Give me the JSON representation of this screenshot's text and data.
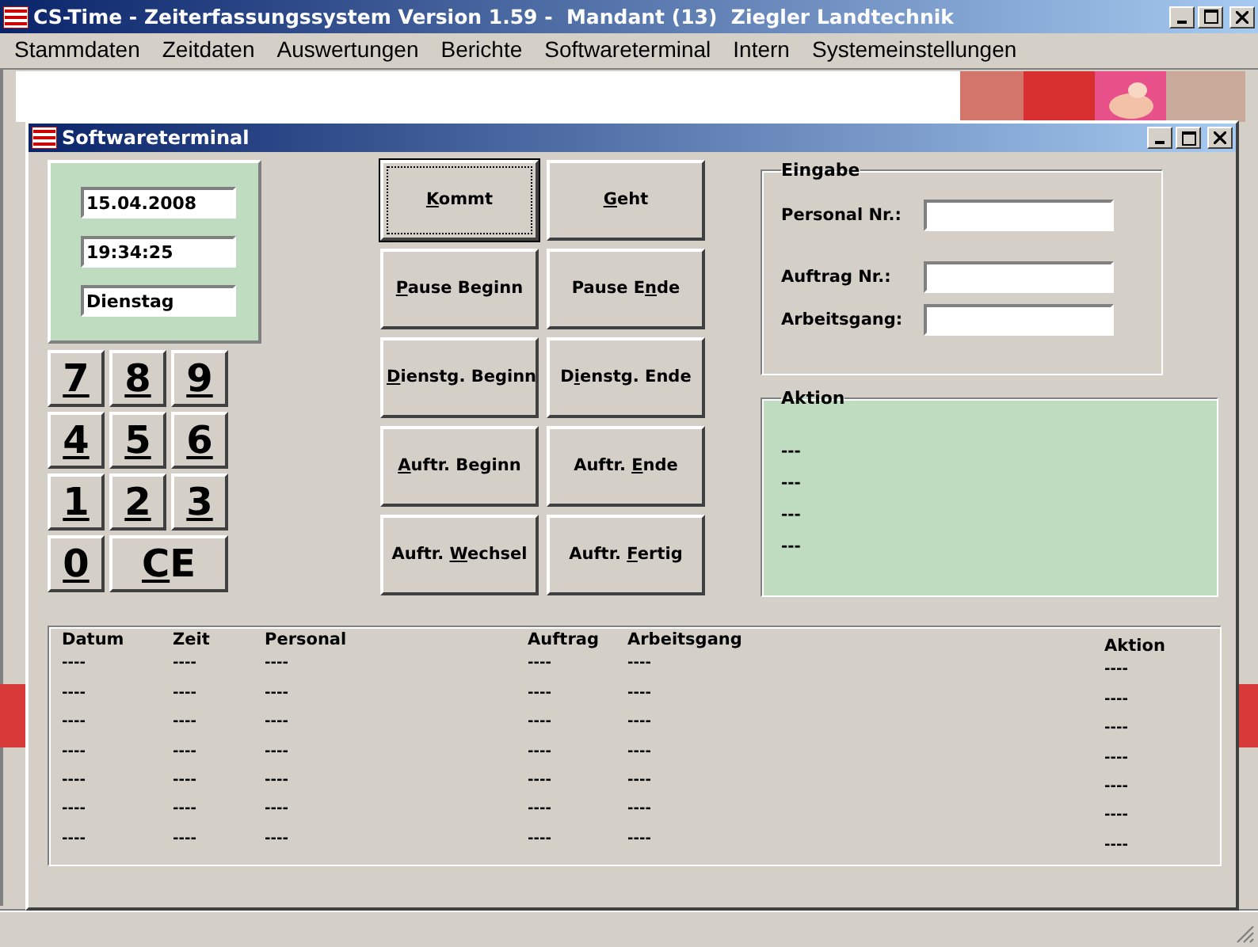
{
  "window": {
    "title": "CS-Time - Zeiterfassungssystem Version 1.59 -  Mandant (13)  Ziegler Landtechnik"
  },
  "menu": [
    "Stammdaten",
    "Zeitdaten",
    "Auswertungen",
    "Berichte",
    "Softwareterminal",
    "Intern",
    "Systemeinstellungen"
  ],
  "terminal": {
    "title": "Softwareterminal",
    "date": "15.04.2008",
    "time": "19:34:25",
    "weekday": "Dienstag",
    "keypad": [
      {
        "key": "7"
      },
      {
        "key": "8"
      },
      {
        "key": "9"
      },
      {
        "key": "4"
      },
      {
        "key": "5"
      },
      {
        "key": "6"
      },
      {
        "key": "1"
      },
      {
        "key": "2"
      },
      {
        "key": "3"
      },
      {
        "key": "0"
      },
      {
        "key": "C",
        "post": "E",
        "wide": true
      }
    ],
    "actions": [
      {
        "key": "K",
        "post": "ommt",
        "focused": true
      },
      {
        "key": "G",
        "post": "eht",
        "focused": false
      },
      {
        "key": "P",
        "post": "ause Beginn",
        "focused": false
      },
      {
        "pre": "Pause E",
        "key": "n",
        "post": "de",
        "focused": false
      },
      {
        "key": "D",
        "post": "ienstg. Beginn",
        "focused": false
      },
      {
        "pre": "D",
        "key": "i",
        "post": "enstg. Ende",
        "focused": false
      },
      {
        "key": "A",
        "post": "uftr. Beginn",
        "focused": false
      },
      {
        "pre": "Auftr. ",
        "key": "E",
        "post": "nde",
        "focused": false
      },
      {
        "pre": "Auftr. ",
        "key": "W",
        "post": "echsel",
        "focused": false
      },
      {
        "pre": "Auftr. ",
        "key": "F",
        "post": "ertig",
        "focused": false
      }
    ],
    "eingabe": {
      "title": "Eingabe",
      "fields": [
        {
          "label": "Personal Nr.:"
        },
        {
          "label": "Auftrag Nr.:"
        },
        {
          "label": "Arbeitsgang:"
        }
      ]
    },
    "aktion": {
      "title": "Aktion",
      "lines": [
        "---",
        "---",
        "---",
        "---"
      ]
    },
    "log": {
      "columns": [
        "Datum",
        "Zeit",
        "Personal",
        "Auftrag",
        "Arbeitsgang",
        "Aktion"
      ],
      "rows": [
        [
          "----",
          "----",
          "----",
          "----",
          "----",
          "----"
        ],
        [
          "----",
          "----",
          "----",
          "----",
          "----",
          "----"
        ],
        [
          "----",
          "----",
          "----",
          "----",
          "----",
          "----"
        ],
        [
          "----",
          "----",
          "----",
          "----",
          "----",
          "----"
        ],
        [
          "----",
          "----",
          "----",
          "----",
          "----",
          "----"
        ],
        [
          "----",
          "----",
          "----",
          "----",
          "----",
          "----"
        ],
        [
          "----",
          "----",
          "----",
          "----",
          "----",
          "----"
        ]
      ]
    }
  }
}
